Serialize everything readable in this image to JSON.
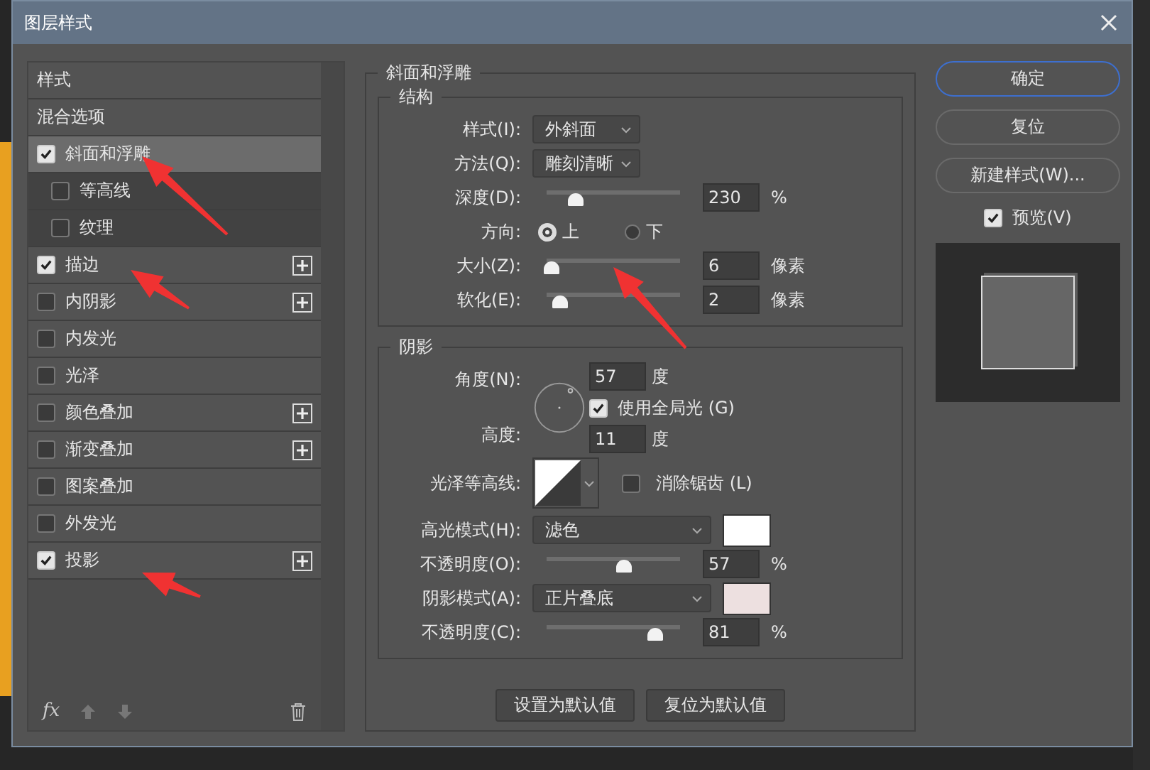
{
  "window": {
    "title": "图层样式"
  },
  "styles_list": {
    "header": "样式",
    "items": [
      {
        "label": "混合选项",
        "kind": "plain",
        "selected": false
      },
      {
        "label": "斜面和浮雕",
        "kind": "check",
        "checked": true,
        "selected": true,
        "add_button": false,
        "children": [
          {
            "label": "等高线",
            "checked": false,
            "selected": false
          },
          {
            "label": "纹理",
            "checked": false,
            "selected": false
          }
        ]
      },
      {
        "label": "描边",
        "kind": "check",
        "checked": true,
        "selected": false,
        "add_button": true
      },
      {
        "label": "内阴影",
        "kind": "check",
        "checked": false,
        "selected": false,
        "add_button": true
      },
      {
        "label": "内发光",
        "kind": "check",
        "checked": false,
        "selected": false,
        "add_button": false
      },
      {
        "label": "光泽",
        "kind": "check",
        "checked": false,
        "selected": false,
        "add_button": false
      },
      {
        "label": "颜色叠加",
        "kind": "check",
        "checked": false,
        "selected": false,
        "add_button": true
      },
      {
        "label": "渐变叠加",
        "kind": "check",
        "checked": false,
        "selected": false,
        "add_button": true
      },
      {
        "label": "图案叠加",
        "kind": "check",
        "checked": false,
        "selected": false,
        "add_button": false
      },
      {
        "label": "外发光",
        "kind": "check",
        "checked": false,
        "selected": false,
        "add_button": false
      },
      {
        "label": "投影",
        "kind": "check",
        "checked": true,
        "selected": false,
        "add_button": true
      }
    ],
    "fx_label": "fx"
  },
  "bevel": {
    "title": "斜面和浮雕",
    "structure": {
      "title": "结构",
      "style": {
        "label": "样式(I):",
        "value": "外斜面"
      },
      "technique": {
        "label": "方法(Q):",
        "value": "雕刻清晰"
      },
      "depth": {
        "label": "深度(D):",
        "level": 0.21,
        "value": "230",
        "unit": "%"
      },
      "direction": {
        "label": "方向:",
        "options": [
          {
            "label": "上",
            "selected": true
          },
          {
            "label": "下",
            "selected": false
          }
        ]
      },
      "size": {
        "label": "大小(Z):",
        "level": 0.03,
        "value": "6",
        "unit": "像素"
      },
      "soften": {
        "label": "软化(E):",
        "level": 0.1,
        "value": "2",
        "unit": "像素"
      }
    },
    "shading": {
      "title": "阴影",
      "angle": {
        "label": "角度(N):",
        "value": "57",
        "unit": "度"
      },
      "global_light": {
        "label": "使用全局光 (G)",
        "checked": true
      },
      "altitude": {
        "label": "高度:",
        "value": "11",
        "unit": "度"
      },
      "gloss_contour": {
        "label": "光泽等高线:"
      },
      "anti_aliased": {
        "label": "消除锯齿 (L)",
        "checked": false
      },
      "highlight_mode": {
        "label": "高光模式(H):",
        "value": "滤色",
        "color": "#ffffff"
      },
      "highlight_opacity": {
        "label": "不透明度(O):",
        "level": 0.57,
        "value": "57",
        "unit": "%"
      },
      "shadow_mode": {
        "label": "阴影模式(A):",
        "value": "正片叠底",
        "color": "#ede0e0"
      },
      "shadow_opacity": {
        "label": "不透明度(C):",
        "level": 0.81,
        "value": "81",
        "unit": "%"
      }
    },
    "buttons": [
      "设置为默认值",
      "复位为默认值"
    ]
  },
  "actions": [
    {
      "label": "确定",
      "default": true
    },
    {
      "label": "复位",
      "default": false
    },
    {
      "label": "新建样式(W)...",
      "default": false
    }
  ],
  "preview": {
    "label": "预览(V)",
    "checked": true
  }
}
